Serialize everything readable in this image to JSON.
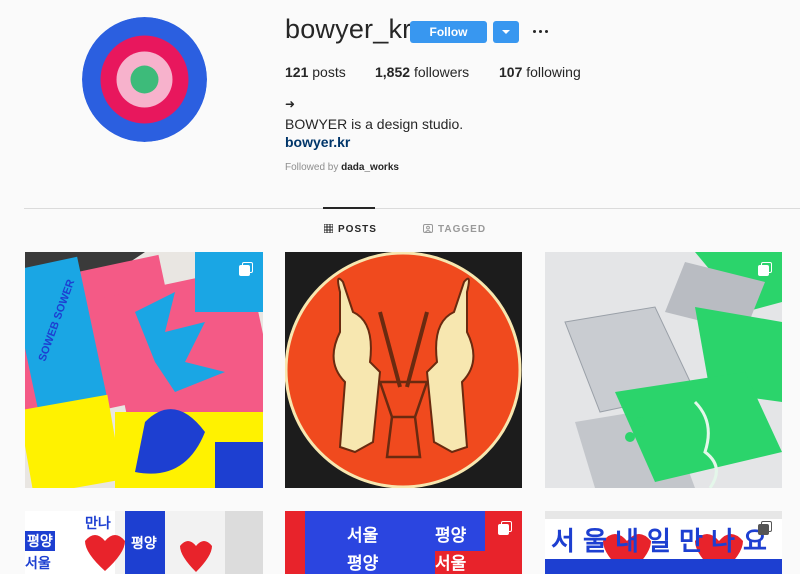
{
  "profile": {
    "username": "bowyer_kr",
    "follow_label": "Follow",
    "posts_count": "121",
    "posts_word": "posts",
    "followers_count": "1,852",
    "followers_word": "followers",
    "following_count": "107",
    "following_word": "following",
    "bio_arrow": "➜",
    "bio": "BOWYER is a design studio.",
    "website": "bowyer.kr",
    "followed_by_prefix": "Followed by",
    "followed_by_user": "dada_works"
  },
  "tabs": [
    {
      "label": "POSTS",
      "active": true
    },
    {
      "label": "TAGGED",
      "active": false
    }
  ],
  "posts": [
    {
      "subject": "riso-print-posters",
      "multi": true
    },
    {
      "subject": "rabbits-mortar-illustration",
      "multi": false
    },
    {
      "subject": "green-silver-booklets",
      "multi": true
    },
    {
      "subject": "korean-text-poster-hearts",
      "multi": false,
      "text": [
        "평양",
        "서울",
        "평양",
        "만나"
      ]
    },
    {
      "subject": "korean-blue-red-poster",
      "multi": true,
      "text": [
        "서울",
        "평양",
        "평양",
        "서울"
      ]
    },
    {
      "subject": "korean-banner-poster",
      "multi": true,
      "text": [
        "서",
        "울",
        "내",
        "일",
        "만",
        "나",
        "요"
      ]
    }
  ],
  "colors": {
    "follow_blue": "#3897f0",
    "link": "#003569",
    "avatar_rings": [
      "#2b5fe0",
      "#e8175d",
      "#f7b2cc",
      "#3dbb7a"
    ]
  }
}
